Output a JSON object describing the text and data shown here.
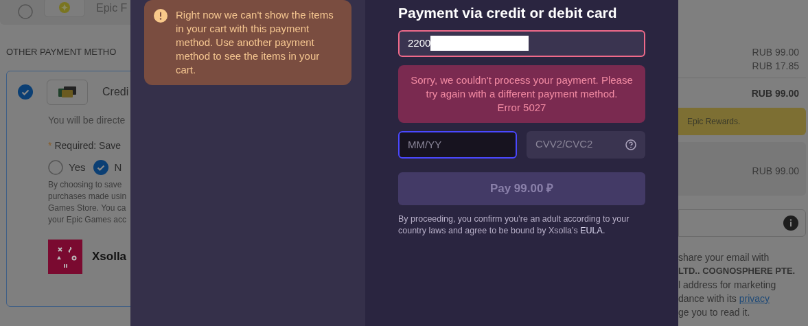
{
  "background_left": {
    "top_method": {
      "label": "Epic F",
      "selected": false
    },
    "section_title": "OTHER PAYMENT METHO",
    "method": {
      "label": "Credi",
      "selected": true,
      "note": "You will be directe",
      "required_label": "Required: Save",
      "required_mark": "*",
      "options": [
        {
          "label": "Yes",
          "selected": false
        },
        {
          "label": "N",
          "selected": true
        }
      ],
      "disclaimer": [
        "By choosing to save",
        "purchases made usin",
        "Games Store. You ca",
        "your Epic Games acc"
      ],
      "provider": "Xsolla"
    }
  },
  "notice": {
    "text": "Right now we can't show the items in your cart with this payment method. Use another payment method to see the items in your cart."
  },
  "payment": {
    "title": "Payment via credit or debit card",
    "card_number": {
      "value": "2200",
      "invalid": true,
      "redacted": true
    },
    "error": {
      "lines": [
        "Sorry, we couldn't process your payment. Please try again with a different payment method.",
        "Error 5027"
      ]
    },
    "expiry": {
      "placeholder": "MM/YY",
      "focused": true
    },
    "cvv": {
      "placeholder": "CVV2/CVC2",
      "focused": false
    },
    "pay_button": {
      "label": "Pay 99.00 ₽",
      "disabled": true
    },
    "legal": {
      "text": "By proceeding, you confirm you’re an adult according to your country laws and agree to be bound by Xsolla’s ",
      "link": "EULA",
      "end": "."
    }
  },
  "background_right": {
    "prices": [
      "RUB 99.00",
      "RUB 17.85"
    ],
    "total": "RUB 99.00",
    "rewards": "Epic Rewards.",
    "item_price": "RUB 99.00",
    "consent": [
      {
        "text": "share your email with",
        "bold": false
      },
      {
        "text": "LTD.. COGNOSPHERE PTE.",
        "bold": true
      },
      {
        "text": "l address for marketing",
        "bold": false
      },
      {
        "text": "dance with its ",
        "link": "privacy",
        "bold": false
      },
      {
        "text": "ge you to read it.",
        "bold": false
      }
    ]
  }
}
